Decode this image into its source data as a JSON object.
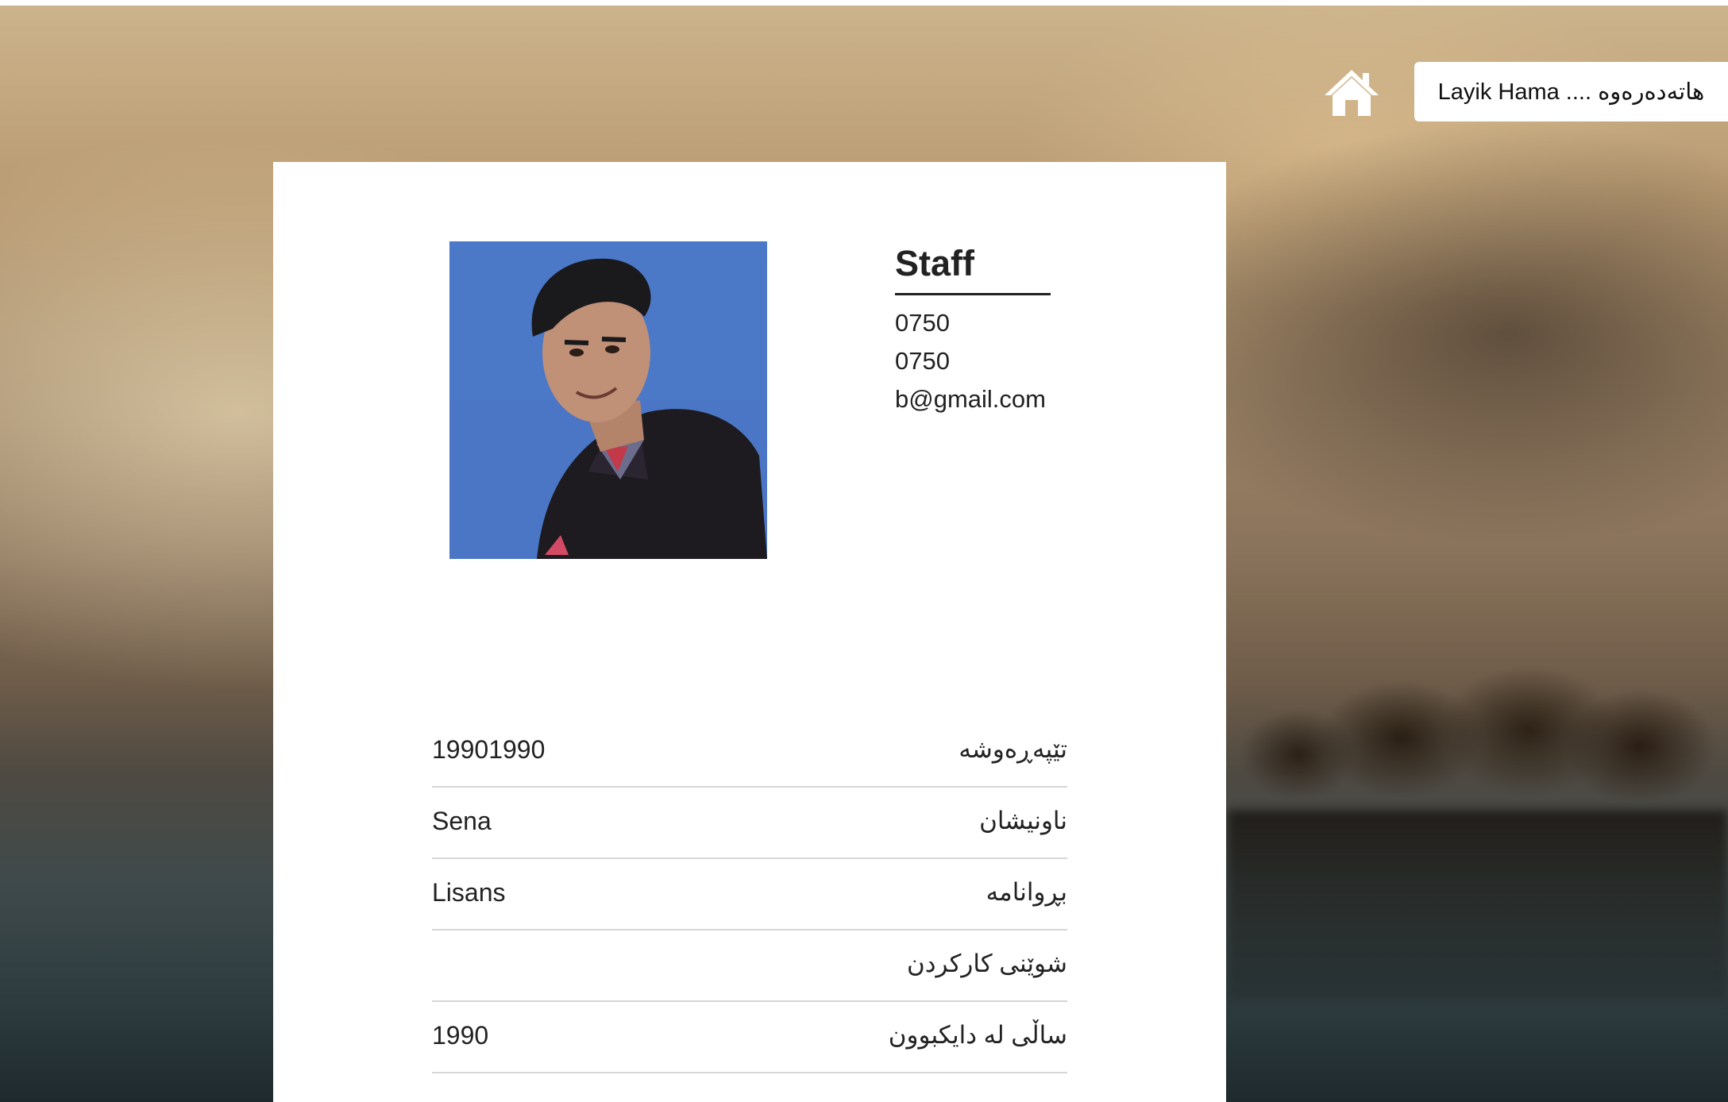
{
  "header": {
    "greeting": "Layik Hama .... هاتەدەرەوە",
    "home_icon": "home-icon"
  },
  "profile": {
    "role": "Staff",
    "phone_1": "0750",
    "phone_2": "0750",
    "email": "b@gmail.com",
    "photo": "profile-photo"
  },
  "details": [
    {
      "label": "تێپەڕەوشە",
      "value": "19901990"
    },
    {
      "label": "ناونیشان",
      "value": "Sena"
    },
    {
      "label": "بڕوانامە",
      "value": "Lisans"
    },
    {
      "label": "شوێنی کارکردن",
      "value": ""
    },
    {
      "label": "ساڵی لە دایکبوون",
      "value": "1990"
    }
  ],
  "colors": {
    "card": "#ffffff",
    "photo_sky": "#4a76c5",
    "text": "#222222"
  }
}
